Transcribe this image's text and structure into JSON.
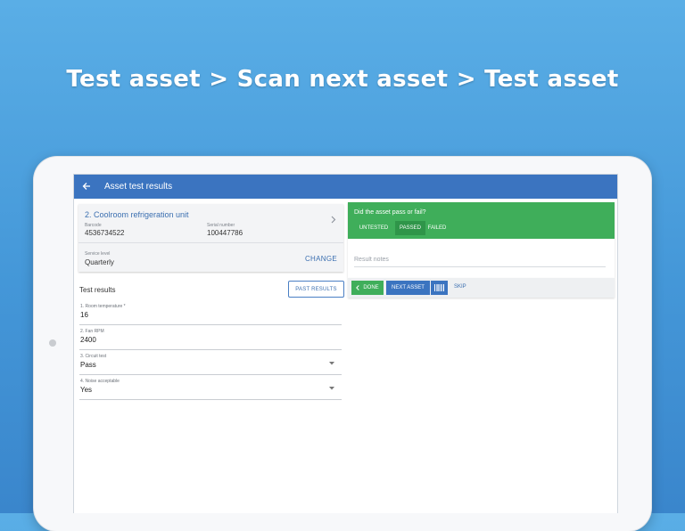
{
  "headline": "Test asset > Scan next asset > Test asset",
  "appbar": {
    "title": "Asset test results"
  },
  "asset": {
    "name": "2. Coolroom refrigeration unit",
    "barcode_label": "Barcode",
    "barcode": "4536734522",
    "serial_label": "Serial number",
    "serial": "100447786",
    "service_level_label": "Service level",
    "service_level": "Quarterly",
    "change_label": "CHANGE"
  },
  "results": {
    "title": "Test results",
    "past_results_label": "PAST RESULTS",
    "fields": [
      {
        "label": "1. Room temperature *",
        "value": "16"
      },
      {
        "label": "2. Fan RPM",
        "value": "2400"
      },
      {
        "label": "3. Circuit test",
        "value": "Pass"
      },
      {
        "label": "4. Noise acceptable",
        "value": "Yes"
      }
    ]
  },
  "outcome": {
    "question": "Did the asset pass or fail?",
    "options": [
      "UNTESTED",
      "PASSED",
      "FAILED"
    ],
    "selected": "PASSED",
    "notes_placeholder": "Result notes",
    "notes_value": ""
  },
  "actions": {
    "done_label": "DONE",
    "next_label": "NEXT ASSET",
    "skip_label": "SKIP"
  },
  "colors": {
    "primary": "#3b74c0",
    "success": "#3fae5a",
    "success_dark": "#2f9549",
    "link": "#3b6fb0"
  },
  "icons": {
    "back": "arrow-left-icon",
    "chevron": "chevron-right-icon",
    "caret": "caret-down-icon",
    "done": "chevron-left-icon",
    "scan": "barcode-icon"
  }
}
